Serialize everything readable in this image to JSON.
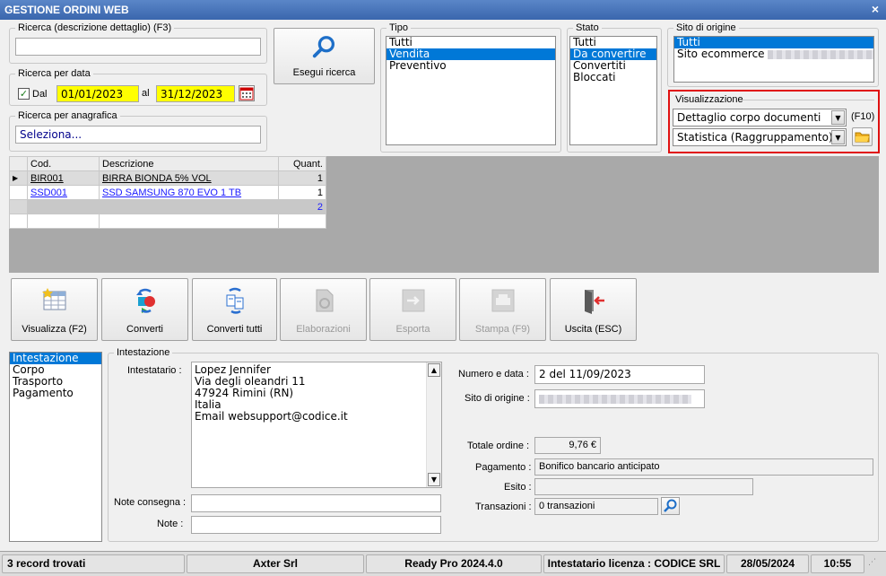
{
  "window": {
    "title": "GESTIONE ORDINI WEB",
    "close": "×"
  },
  "search": {
    "detail_label": "Ricerca (descrizione dettaglio) (F3)",
    "detail_value": "",
    "date_group_label": "Ricerca per data",
    "date_check_label": "Dal",
    "date_from": "01/01/2023",
    "date_to_label": "al",
    "date_to": "31/12/2023",
    "anagrafica_label": "Ricerca per anagrafica",
    "anagrafica_value": "Seleziona...",
    "run_button": "Esegui ricerca"
  },
  "tipo": {
    "label": "Tipo",
    "items": [
      "Tutti",
      "Vendita",
      "Preventivo"
    ],
    "selected": 1
  },
  "stato": {
    "label": "Stato",
    "items": [
      "Tutti",
      "Da convertire",
      "Convertiti",
      "Bloccati"
    ],
    "selected": 1
  },
  "sito": {
    "label": "Sito di origine",
    "items": [
      "Tutti",
      "Sito ecommerce"
    ],
    "selected": 0
  },
  "visualizzazione": {
    "label": "Visualizzazione",
    "combo1": "Dettaglio corpo documenti",
    "shortcut": "(F10)",
    "combo2": "Statistica (Raggruppamento)"
  },
  "grid": {
    "headers": [
      "Cod.",
      "Descrizione",
      "Quant."
    ],
    "rows": [
      {
        "cod": "BIR001",
        "desc": "BIRRA BIONDA 5% VOL",
        "qty": "1"
      },
      {
        "cod": "SSD001",
        "desc": "SSD SAMSUNG 870 EVO 1 TB",
        "qty": "1"
      }
    ],
    "total": "2"
  },
  "toolbar": {
    "visualizza": "Visualizza (F2)",
    "converti": "Converti",
    "converti_tutti": "Converti tutti",
    "elaborazioni": "Elaborazioni",
    "esporta": "Esporta",
    "stampa": "Stampa (F9)",
    "uscita": "Uscita (ESC)"
  },
  "sections": [
    "Intestazione",
    "Corpo",
    "Trasporto",
    "Pagamento"
  ],
  "intestazione": {
    "group_label": "Intestazione",
    "intestatario_label": "Intestatario :",
    "intestatario_lines": [
      "Lopez Jennifer",
      "Via degli oleandri 11",
      "47924 Rimini (RN)",
      "Italia",
      "Email websupport@codice.it"
    ],
    "note_consegna_label": "Note consegna :",
    "note_label": "Note :",
    "numero_label": "Numero e data :",
    "numero_value": "2 del 11/09/2023",
    "sito_label": "Sito di origine :",
    "totale_label": "Totale ordine :",
    "totale_value": "9,76 €",
    "pagamento_label": "Pagamento :",
    "pagamento_value": "Bonifico bancario anticipato",
    "esito_label": "Esito :",
    "transazioni_label": "Transazioni :",
    "transazioni_value": "0 transazioni"
  },
  "status": {
    "records": "3 record trovati",
    "company": "Axter Srl",
    "version": "Ready Pro 2024.4.0",
    "license": "Intestatario licenza : CODICE SRL",
    "date": "28/05/2024",
    "time": "10:55"
  }
}
